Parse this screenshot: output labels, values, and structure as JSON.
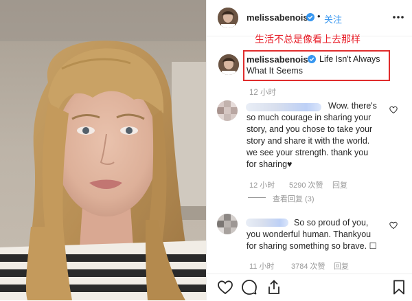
{
  "post": {
    "username": "melissabenoist",
    "follow_label": "关注",
    "separator": "•",
    "annotation": "生活不总是像看上去那样",
    "caption_line1": "Life Isn't Always",
    "caption_line2": "What It Seems",
    "caption_time": "12 小时"
  },
  "comments": [
    {
      "lines": [
        "Wow. there's",
        "so much courage in sharing your",
        "story, and you chose to take your",
        "story and share it with the world.",
        "we see your strength. thank you",
        "for sharing♥"
      ],
      "time": "12 小时",
      "likes": "5290 次赞",
      "reply": "回复",
      "view_replies": "查看回复 (3)"
    },
    {
      "lines": [
        "So so proud of you,",
        "you wonderful human. Thankyou",
        "for sharing something so brave. ☐"
      ],
      "time": "11 小时",
      "likes": "3784 次赞",
      "reply": "回复"
    }
  ],
  "icons": {
    "verified": "verified-badge-icon",
    "more": "more-options-icon",
    "heart": "heart-icon",
    "comment": "comment-icon",
    "share": "share-icon",
    "bookmark": "bookmark-icon"
  },
  "colors": {
    "follow": "#3897f0",
    "annotation": "#e8202a",
    "highlight_border": "#e02c2c",
    "verified": "#3897f0"
  }
}
